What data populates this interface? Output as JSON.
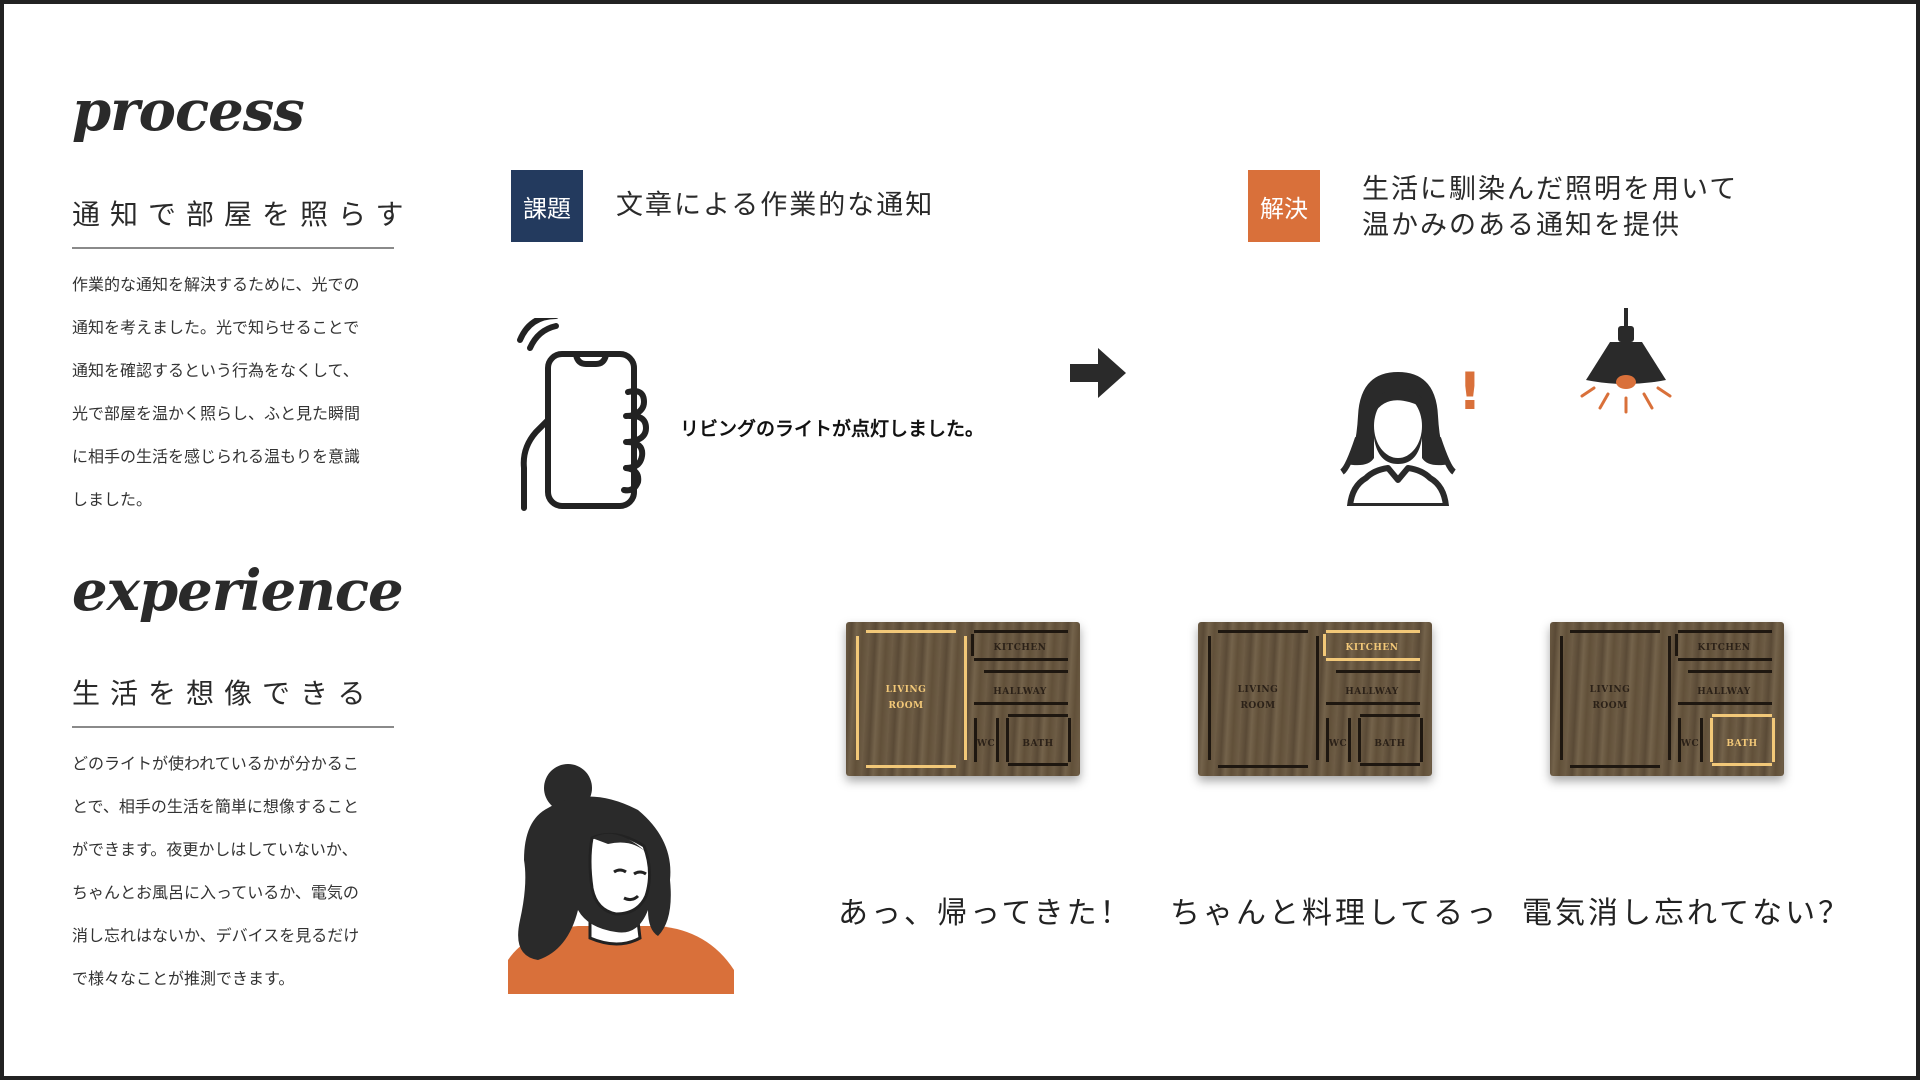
{
  "colors": {
    "navy": "#233a5e",
    "orange": "#d9703a",
    "dark": "#2a2a2a",
    "rule": "#8a8a8a",
    "wood": "#6b5a43",
    "glow": "#f2c878"
  },
  "process": {
    "heading": "process",
    "subtitle": "通知で部屋を照らす",
    "body_lines": [
      "作業的な通知を解決するために、光での",
      "通知を考えました。光で知らせることで",
      "通知を確認するという行為をなくして、",
      "光で部屋を温かく照らし、ふと見た瞬間",
      "に相手の生活を感じられる温もりを意識",
      "しました。"
    ]
  },
  "experience": {
    "heading": "experience",
    "subtitle": "生活を想像できる",
    "body_lines": [
      "どのライトが使われているかが分かるこ",
      "とで、相手の生活を簡単に想像すること",
      "ができます。夜更かしはしていないか、",
      "ちゃんとお風呂に入っているか、電気の",
      "消し忘れはないか、デバイスを見るだけ",
      "で様々なことが推測できます。"
    ]
  },
  "problem": {
    "tag": "課題",
    "text": "文章による作業的な通知",
    "notification": "リビングのライトが点灯しました。"
  },
  "solution": {
    "tag": "解決",
    "line1": "生活に馴染んだ照明を用いて",
    "line2": "温かみのある通知を提供",
    "exclaim": "!"
  },
  "floor_panel": {
    "living_line1": "LIVING",
    "living_line2": "ROOM",
    "kitchen": "KITCHEN",
    "hallway": "HALLWAY",
    "wc": "WC",
    "bath": "BATH"
  },
  "panels": [
    {
      "lit_room": "living",
      "caption": "あっ、帰ってきた！"
    },
    {
      "lit_room": "kitchen",
      "caption": "ちゃんと料理してるっ"
    },
    {
      "lit_room": "bath",
      "caption": "電気消し忘れてない？"
    }
  ]
}
